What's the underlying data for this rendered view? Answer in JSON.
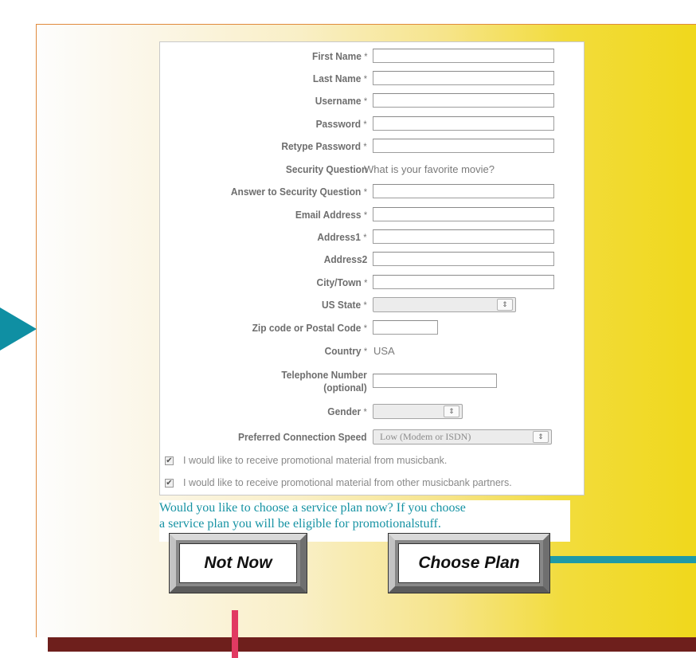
{
  "form": {
    "rows": [
      {
        "label": "First Name",
        "star": "*"
      },
      {
        "label": "Last Name",
        "star": "*"
      },
      {
        "label": "Username",
        "star": "*"
      },
      {
        "label": "Password",
        "star": "*"
      },
      {
        "label": "Retype Password",
        "star": "*"
      },
      {
        "label": "Security Question",
        "value": "What is your favorite movie?"
      },
      {
        "label": "Answer to Security Question",
        "star": "*"
      },
      {
        "label": "Email Address",
        "star": "*"
      },
      {
        "label": "Address1",
        "star": "*"
      },
      {
        "label": "Address2"
      },
      {
        "label": "City/Town",
        "star": "*"
      },
      {
        "label": "US State",
        "star": "*"
      },
      {
        "label": "Zip code or Postal Code",
        "star": "*"
      },
      {
        "label": "Country",
        "star": "*",
        "value": "USA"
      },
      {
        "label_line1": "Telephone Number",
        "label_line2": "(optional)"
      },
      {
        "label": "Gender",
        "star": "*"
      },
      {
        "label": "Preferred Connection Speed",
        "select_value": "Low (Modem or ISDN)"
      }
    ],
    "checkboxes": [
      {
        "label": "I would like to receive promotional material from musicbank.",
        "checked": true
      },
      {
        "label": "I would like to receive promotional material from other musicbank partners.",
        "checked": true
      }
    ]
  },
  "promo_text": {
    "line1": "Would you like to choose a service plan now? If you choose",
    "line2": "a service plan you will be eligible for promotionalstuff."
  },
  "buttons": {
    "not_now": "Not Now",
    "choose_plan": "Choose Plan"
  },
  "icons": {
    "select_arrows": "⇕",
    "checkmark": "✔"
  },
  "colors": {
    "accent_teal": "#1592a3",
    "accent_pink": "#e13a62",
    "shadow": "#6e1f1c"
  }
}
